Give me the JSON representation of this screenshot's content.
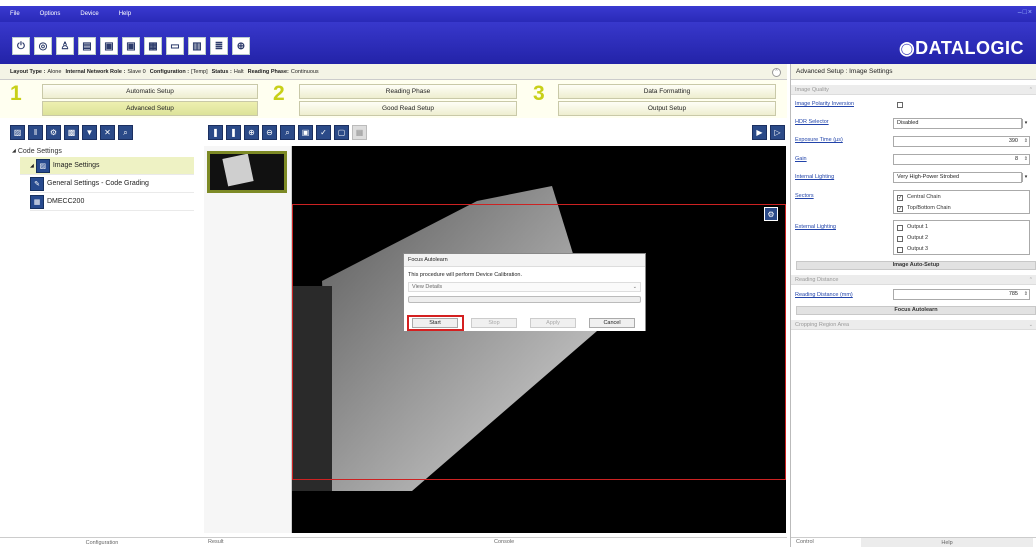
{
  "menu": [
    "File",
    "Options",
    "Device",
    "Help"
  ],
  "window_controls": "–□×",
  "logo_text": "◉DATALOGIC",
  "toolbar_icons": [
    "power-icon",
    "record-icon",
    "user-icon",
    "doc-icon",
    "chip-icon",
    "chip2-icon",
    "grid-icon",
    "monitor-icon",
    "save-icon",
    "compare-icon",
    "target-icon"
  ],
  "status": {
    "layout_type_label": "Layout Type :",
    "layout_type": "Alone",
    "network_role_label": "Internal Network Role :",
    "network_role": "Slave 0",
    "configuration_label": "Configuration :",
    "configuration": "[Temp]",
    "status_label": "Status :",
    "status": "Halt",
    "reading_phase_label": "Reading Phase:",
    "reading_phase": "Continuous"
  },
  "wizard": {
    "steps": [
      {
        "num": "1",
        "buttons": [
          "Automatic Setup",
          "Advanced Setup"
        ]
      },
      {
        "num": "2",
        "buttons": [
          "Reading Phase",
          "Good Read Setup"
        ]
      },
      {
        "num": "3",
        "buttons": [
          "Data Formatting",
          "Output Setup"
        ]
      }
    ],
    "active": "Advanced Setup"
  },
  "tree": {
    "root": "Code Settings",
    "items": [
      "Image Settings",
      "General Settings - Code Grading",
      "DMECC200"
    ]
  },
  "left_tab": "Configuration",
  "center_tabs": [
    "Result",
    "Console"
  ],
  "dialog": {
    "title": "Focus Autolearn",
    "message": "This procedure will perform Device Calibration.",
    "details": "View Details",
    "buttons": {
      "start": "Start",
      "stop": "Stop",
      "apply": "Apply",
      "cancel": "Cancel"
    }
  },
  "right": {
    "title": "Advanced Setup : Image Settings",
    "section_quality": "Image Quality",
    "image_polarity_label": "Image Polarity Inversion",
    "hdr_label": "HDR Selector",
    "hdr_value": "Disabled",
    "exposure_label": "Exposure Time (µs)",
    "exposure_value": "390",
    "gain_label": "Gain",
    "gain_value": "8",
    "internal_lighting_label": "Internal Lighting",
    "internal_lighting_value": "Very High-Power Strobed",
    "sectors_label": "Sectors",
    "sectors": [
      "Central Chain",
      "Top/Bottom Chain"
    ],
    "external_lighting_label": "External Lighting",
    "external_outputs": [
      "Output 1",
      "Output 2",
      "Output 3"
    ],
    "image_auto_setup": "Image Auto-Setup",
    "section_reading_distance": "Reading Distance",
    "reading_distance_label": "Reading Distance (mm)",
    "reading_distance_value": "785",
    "focus_autolearn": "Focus Autolearn",
    "section_cropping": "Cropping Region Area",
    "tabs": [
      "Control",
      "Help"
    ]
  },
  "colors": {
    "brand_blue": "#2a2ab8",
    "wizard_number": "#c8d018",
    "highlight_red": "#d42020"
  }
}
